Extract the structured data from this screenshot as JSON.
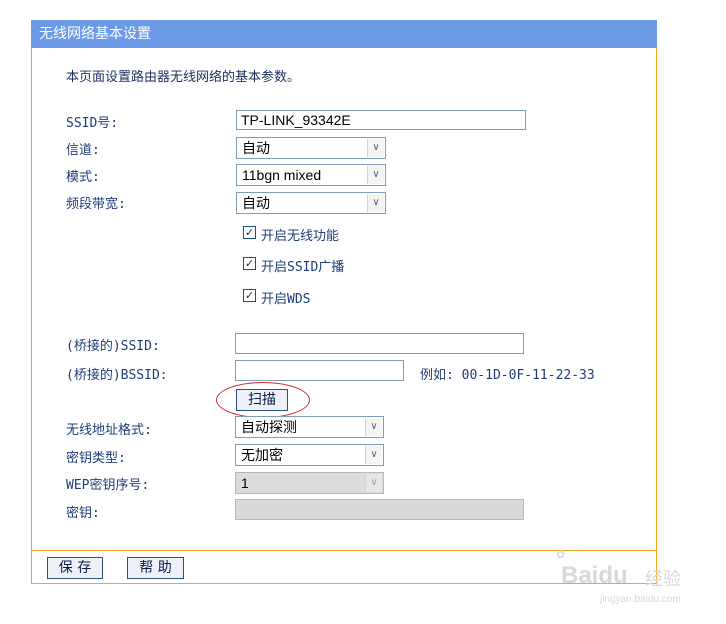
{
  "title": "无线网络基本设置",
  "description": "本页面设置路由器无线网络的基本参数。",
  "fields": {
    "ssid_label": "SSID号:",
    "ssid_value": "TP-LINK_93342E",
    "channel_label": "信道:",
    "channel_value": "自动",
    "mode_label": "模式:",
    "mode_value": "11bgn mixed",
    "bandwidth_label": "频段带宽:",
    "bandwidth_value": "自动"
  },
  "checkboxes": {
    "wireless_enable": {
      "label": "开启无线功能",
      "checked": true
    },
    "ssid_broadcast": {
      "label": "开启SSID广播",
      "checked": true
    },
    "wds": {
      "label": "开启WDS",
      "checked": true
    }
  },
  "wds": {
    "bridged_ssid_label": "(桥接的)SSID:",
    "bridged_ssid_value": "",
    "bridged_bssid_label": "(桥接的)BSSID:",
    "bridged_bssid_value": "",
    "example_text": "例如: 00-1D-0F-11-22-33",
    "scan_label": "扫描",
    "address_format_label": "无线地址格式:",
    "address_format_value": "自动探测",
    "key_type_label": "密钥类型:",
    "key_type_value": "无加密",
    "wep_index_label": "WEP密钥序号:",
    "wep_index_value": "1",
    "key_label": "密钥:",
    "key_value": ""
  },
  "buttons": {
    "save": "保 存",
    "help": "帮 助"
  },
  "watermark": {
    "brand": "Baidu",
    "suffix": "经验",
    "url": "jingyan.baidu.com"
  },
  "colors": {
    "titlebar": "#6d9ae6",
    "border": "#f5a623",
    "highlight": "#d2242a"
  }
}
